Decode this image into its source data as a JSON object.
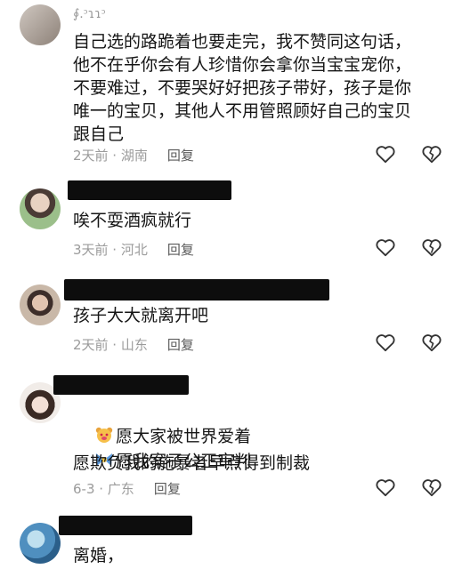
{
  "comments": [
    {
      "username": "∮.ᵓɿɿᵓ",
      "lines": [
        "自己选的路跪着也要走完，我不赞同这句话，",
        "他不在乎你会有人珍惜你会拿你当宝宝宠你，",
        "不要难过，不要哭好好把孩子带好，孩子是你",
        "唯一的宝贝，其他人不用管照顾好自己的宝贝",
        "跟自己"
      ],
      "meta": "2天前 · 湖南",
      "reply": "回复"
    },
    {
      "lines": [
        "唉不耍酒疯就行"
      ],
      "meta": "3天前 · 河北",
      "reply": "回复"
    },
    {
      "lines": [
        "孩子大大就离开吧"
      ],
      "meta": "2天前 · 山东",
      "reply": "回复"
    },
    {
      "lines": [
        "愿大家被世界爱着",
        "愿我案子公正审判",
        "愿欺负我的施暴者早点得到制裁"
      ],
      "meta": "6-3 · 广东",
      "reply": "回复"
    },
    {
      "lines": [
        "离婚，"
      ]
    }
  ],
  "icons": {
    "like": "heart-outline-icon",
    "dislike": "broken-heart-icon",
    "emoji1": "bear-face-emoji",
    "emoji2": "bow-emoji"
  },
  "colors": {
    "meta": "#9b9b9b",
    "text": "#161616",
    "redaction": "#0d0d0d"
  }
}
